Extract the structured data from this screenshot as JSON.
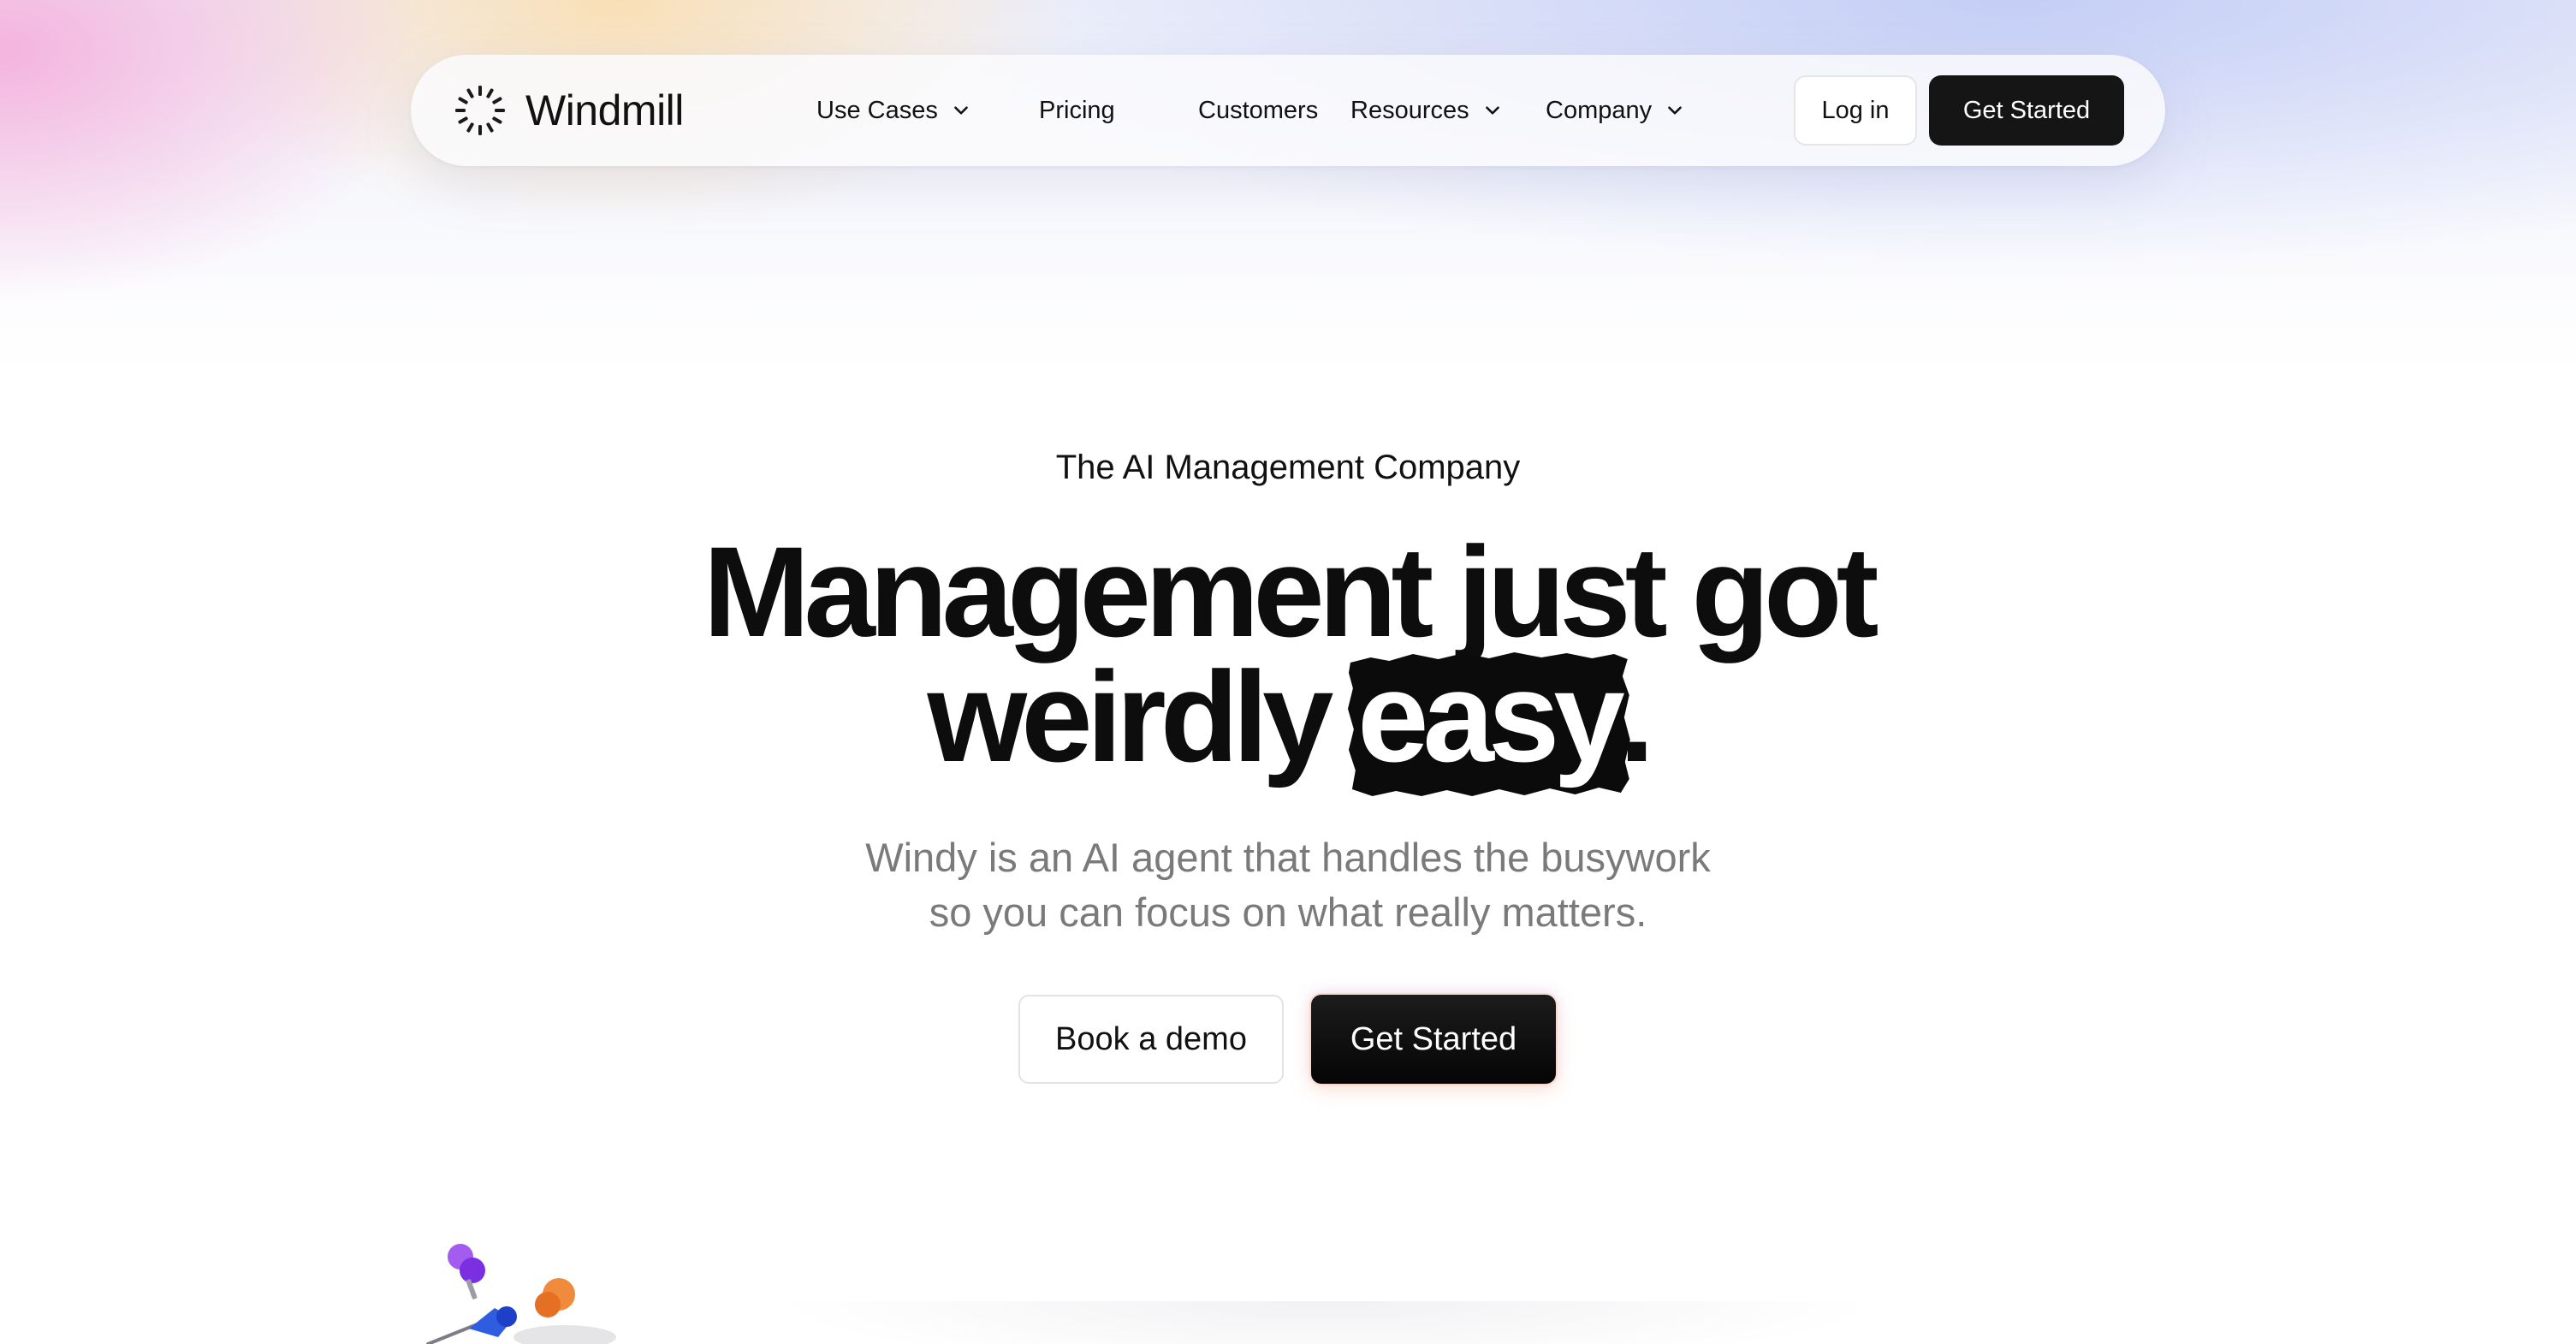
{
  "brand": {
    "name": "Windmill",
    "logo_icon": "windmill-logo-icon"
  },
  "nav": {
    "items": [
      {
        "label": "Use Cases",
        "has_dropdown": true
      },
      {
        "label": "Pricing",
        "has_dropdown": false
      },
      {
        "label": "Customers",
        "has_dropdown": false
      },
      {
        "label": "Resources",
        "has_dropdown": true
      },
      {
        "label": "Company",
        "has_dropdown": true
      }
    ],
    "login_label": "Log in",
    "get_started_label": "Get Started"
  },
  "hero": {
    "eyebrow": "The AI Management Company",
    "headline_line1": "Management just got",
    "headline_line2_prefix": "weirdly ",
    "headline_highlight": "easy",
    "headline_suffix": ".",
    "subhead_line1": "Windy is an AI agent that handles the busywork",
    "subhead_line2": "so you can focus on what really matters.",
    "demo_label": "Book a demo",
    "get_started_label": "Get Started"
  },
  "colors": {
    "primary_button": "#151515",
    "text_primary": "#111111",
    "text_muted": "#7a7a7a",
    "pin_purple": "#8a3ee8",
    "pin_blue": "#2f5de0",
    "pin_orange": "#f08a3c"
  },
  "decor": {
    "pins_icon": "push-pins-icon"
  }
}
